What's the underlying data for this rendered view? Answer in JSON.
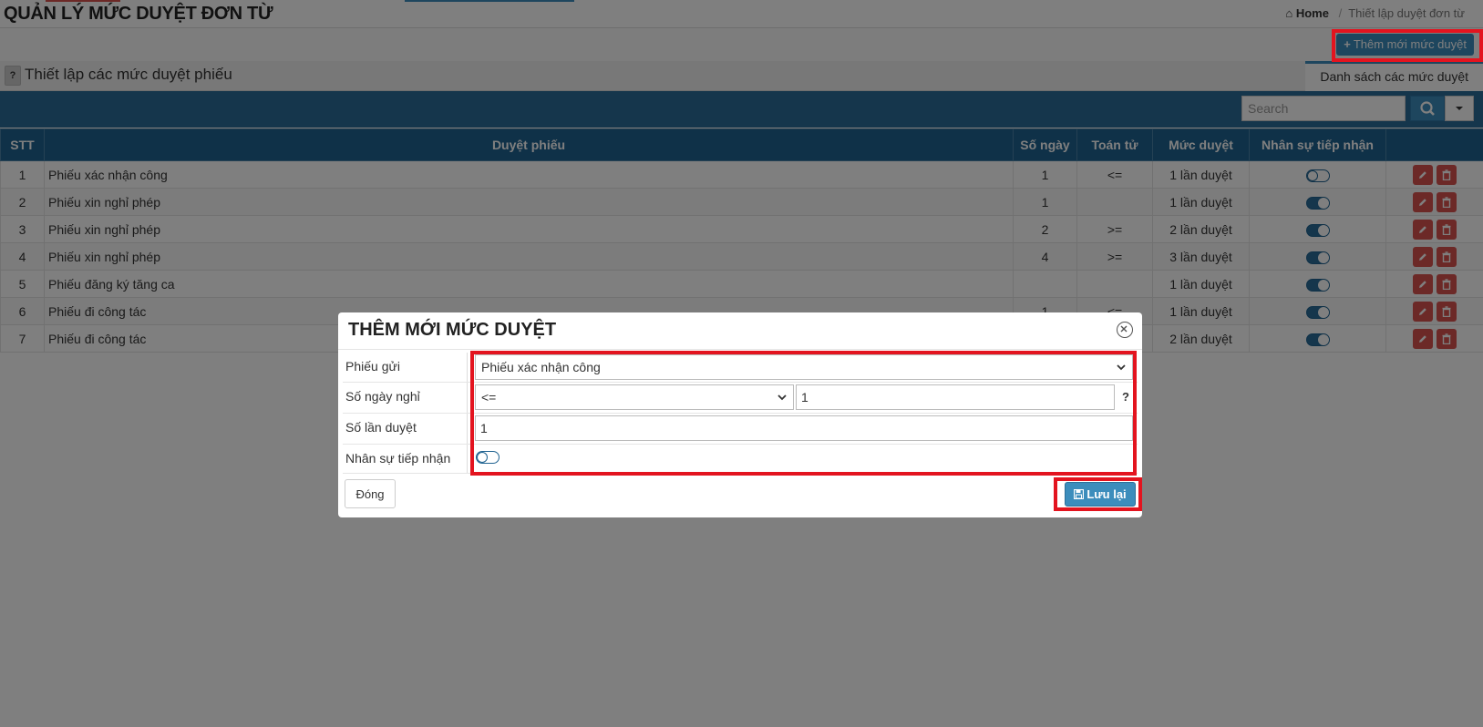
{
  "header": {
    "title": "QUẢN LÝ MỨC DUYỆT ĐƠN TỪ",
    "breadcrumb_home": "Home",
    "breadcrumb_current": "Thiết lập duyệt đơn từ",
    "add_button": "Thêm mới mức duyệt"
  },
  "section": {
    "help": "?",
    "title": "Thiết lập các mức duyệt phiếu",
    "tab_list": "Danh sách các mức duyệt"
  },
  "search": {
    "placeholder": "Search"
  },
  "table": {
    "columns": [
      "STT",
      "Duyệt phiếu",
      "Số ngày",
      "Toán tử",
      "Mức duyệt",
      "Nhân sự tiếp nhận",
      ""
    ],
    "rows": [
      {
        "stt": "1",
        "phieu": "Phiếu xác nhận công",
        "ngay": "1",
        "toan_tu": "<=",
        "muc": "1 lần duyệt",
        "nhan_su": false
      },
      {
        "stt": "2",
        "phieu": "Phiếu xin nghỉ phép",
        "ngay": "1",
        "toan_tu": "",
        "muc": "1 lần duyệt",
        "nhan_su": true
      },
      {
        "stt": "3",
        "phieu": "Phiếu xin nghỉ phép",
        "ngay": "2",
        "toan_tu": ">=",
        "muc": "2 lần duyệt",
        "nhan_su": true
      },
      {
        "stt": "4",
        "phieu": "Phiếu xin nghỉ phép",
        "ngay": "4",
        "toan_tu": ">=",
        "muc": "3 lần duyệt",
        "nhan_su": true
      },
      {
        "stt": "5",
        "phieu": "Phiếu đăng ký tăng ca",
        "ngay": "",
        "toan_tu": "",
        "muc": "1 lần duyệt",
        "nhan_su": true
      },
      {
        "stt": "6",
        "phieu": "Phiếu đi công tác",
        "ngay": "1",
        "toan_tu": "<=",
        "muc": "1 lần duyệt",
        "nhan_su": true
      },
      {
        "stt": "7",
        "phieu": "Phiếu đi công tác",
        "ngay": "",
        "toan_tu": "",
        "muc": "2 lần duyệt",
        "nhan_su": true
      }
    ]
  },
  "modal": {
    "title": "THÊM MỚI MỨC DUYỆT",
    "fields": {
      "phieu_gui_label": "Phiếu gửi",
      "phieu_gui_value": "Phiếu xác nhận công",
      "so_ngay_label": "Số ngày nghỉ",
      "so_ngay_operator": "<=",
      "so_ngay_value": "1",
      "so_ngay_help": "?",
      "so_lan_label": "Số lần duyệt",
      "so_lan_value": "1",
      "nhan_su_label": "Nhân sự tiếp nhận"
    },
    "close_button": "Đóng",
    "save_button": "Lưu lại"
  },
  "colors": {
    "primary": "#3c8dbc",
    "table_header": "#1f6290",
    "danger": "#d9534f",
    "highlight": "#e3141f"
  }
}
